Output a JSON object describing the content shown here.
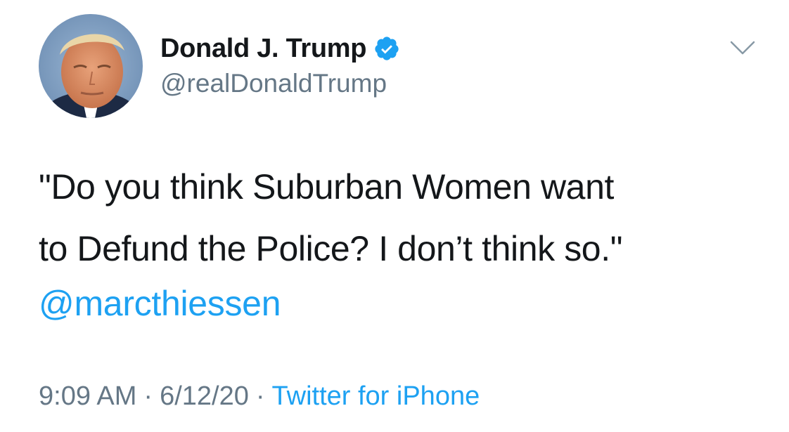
{
  "author": {
    "display_name": "Donald J. Trump",
    "handle": "@realDonaldTrump",
    "verified": true,
    "avatar_icon": "profile-photo"
  },
  "tweet": {
    "text_line_1": "\"Do you think Suburban Women want",
    "text_line_2": "to Defund the Police? I don’t think so.\"",
    "mention": "@marcthiessen"
  },
  "meta": {
    "time": "9:09 AM",
    "separator": "·",
    "date": "6/12/20",
    "source": "Twitter for iPhone"
  },
  "icons": {
    "verified": "verified-badge-icon",
    "menu": "chevron-down-icon"
  },
  "colors": {
    "text": "#14171a",
    "secondary": "#657786",
    "link": "#1da1f2"
  }
}
